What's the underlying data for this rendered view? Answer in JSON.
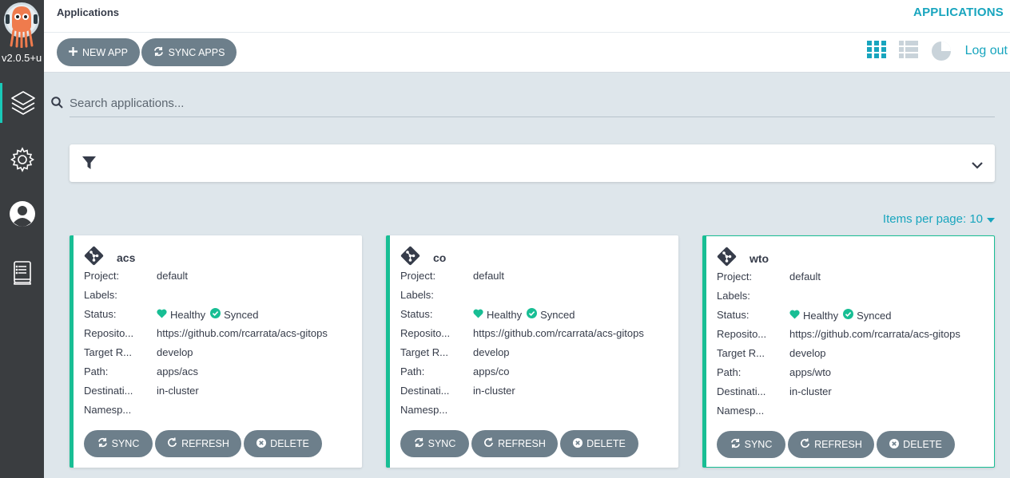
{
  "sidebar": {
    "version": "v2.0.5+u",
    "items": [
      {
        "icon": "layers-icon",
        "active": true
      },
      {
        "icon": "gear-icon",
        "active": false
      },
      {
        "icon": "user-icon",
        "active": false
      },
      {
        "icon": "docs-icon",
        "active": false
      }
    ]
  },
  "header": {
    "breadcrumb": "Applications",
    "title": "APPLICATIONS"
  },
  "toolbar": {
    "new_app": "NEW APP",
    "sync_apps": "SYNC APPS",
    "logout": "Log out",
    "views": [
      "tiles-view-icon",
      "list-view-icon",
      "summary-view-icon"
    ]
  },
  "search": {
    "placeholder": "Search applications..."
  },
  "pagination": {
    "items_per_page": "Items per page: 10"
  },
  "labels": {
    "project": "Project:",
    "labels": "Labels:",
    "status": "Status:",
    "repository": "Reposito...",
    "target": "Target R...",
    "path": "Path:",
    "destination": "Destinati...",
    "namespace": "Namesp..."
  },
  "buttons": {
    "sync": "SYNC",
    "refresh": "REFRESH",
    "delete": "DELETE"
  },
  "apps": [
    {
      "name": "acs",
      "project": "default",
      "labels": "",
      "health": "Healthy",
      "sync": "Synced",
      "repository": "https://github.com/rcarrata/acs-gitops",
      "target": "develop",
      "path": "apps/acs",
      "destination": "in-cluster",
      "namespace": ""
    },
    {
      "name": "co",
      "project": "default",
      "labels": "",
      "health": "Healthy",
      "sync": "Synced",
      "repository": "https://github.com/rcarrata/acs-gitops",
      "target": "develop",
      "path": "apps/co",
      "destination": "in-cluster",
      "namespace": ""
    },
    {
      "name": "wto",
      "project": "default",
      "labels": "",
      "health": "Healthy",
      "sync": "Synced",
      "repository": "https://github.com/rcarrata/acs-gitops",
      "target": "develop",
      "path": "apps/wto",
      "destination": "in-cluster",
      "namespace": ""
    }
  ],
  "colors": {
    "accent": "#18a5be",
    "healthy": "#18be94",
    "button": "#6d7f8b",
    "sidebar": "#3a3d40"
  }
}
